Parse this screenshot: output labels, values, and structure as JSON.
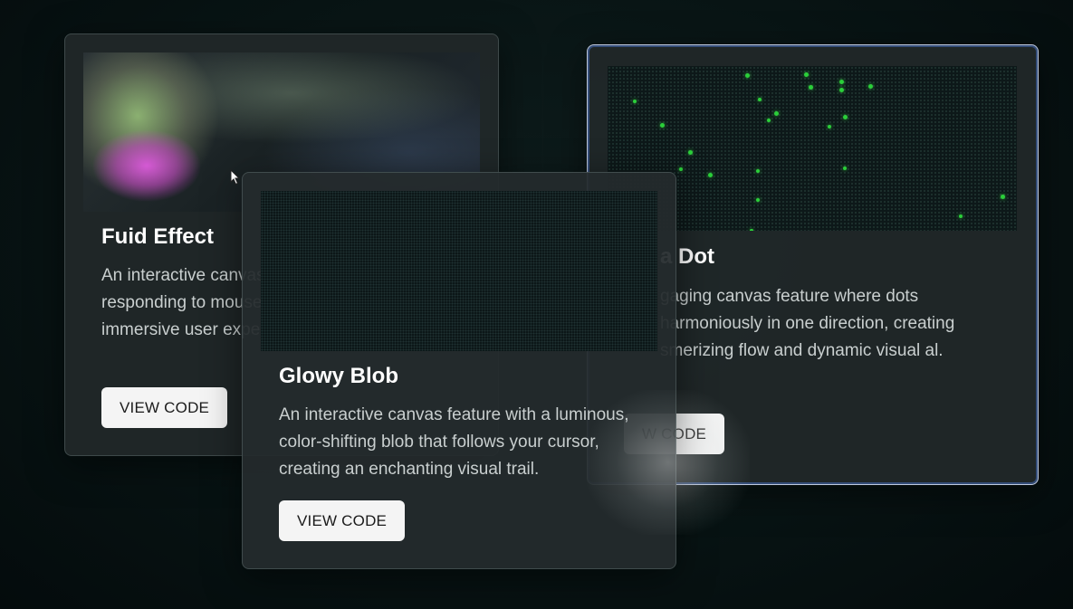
{
  "cards": [
    {
      "title": "Fuid Effect",
      "description": "An interactive canvas feature with flowing visuals responding to mouse hover, creating an immersive user experience.",
      "button_label": "VIEW CODE"
    },
    {
      "title": "Glowy Blob",
      "description": "An interactive canvas feature with a luminous, color-shifting blob that follows your cursor, creating an enchanting visual trail.",
      "button_label": "VIEW CODE"
    },
    {
      "title": "a Dot",
      "description": "gaging canvas feature where dots harmoniously in one direction, creating smerizing flow and dynamic visual al.",
      "button_label": "W CODE"
    }
  ],
  "colors": {
    "dot": "#2bcf3a",
    "button_bg": "#f4f4f4",
    "card_bg": "#20282a",
    "page_bg": "#081414"
  },
  "icons": {
    "cursor": "mouse-pointer-icon"
  }
}
